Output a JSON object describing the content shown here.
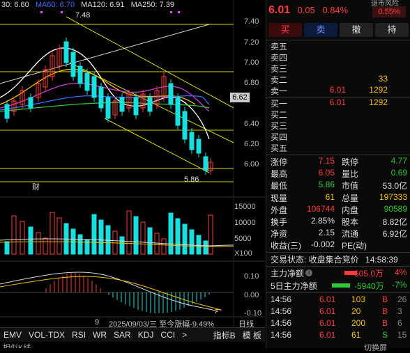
{
  "chart": {
    "legend": [
      {
        "text": "30: 6.60",
        "color": "#dddddd"
      },
      {
        "text": "MA60: 6.70",
        "color": "#3d6bff"
      },
      {
        "text": "MA120: 6.91",
        "color": "#dddddd"
      },
      {
        "text": "MA250: 7.39",
        "color": "#dddddd"
      }
    ],
    "price_ticks": [
      "7.40",
      "7.20",
      "7.00",
      "6.80",
      "6.60",
      "6.40",
      "6.20",
      "6.00"
    ],
    "current_price_tag": "6.62",
    "high_label": "7.48",
    "low_label": "5.86",
    "volume_ticks": [
      "15000",
      "10000",
      "5000",
      "X100"
    ],
    "macd_ticks": [
      "0.10",
      "0.00",
      "-0.10"
    ],
    "marker_char": "财",
    "bottom_info": "2025/09/03/三  至今涨幅-9.49%",
    "bottom_prefix": "9",
    "timeframe": "日线",
    "tabs": [
      "EMV",
      "VOL-TDX",
      "RSI",
      "WR",
      "SAR",
      "KDJ",
      "CCI",
      ">"
    ],
    "tab_right": [
      "指标B",
      "模 板"
    ],
    "bottom_cut": "相似K线",
    "bottom_cut_right": "切换屏"
  },
  "quote": {
    "price": "6.01",
    "change": "0.05",
    "change_pct": "0.84%",
    "ratio": "0.55%",
    "top_cut": "退市风险",
    "buttons": [
      {
        "label": "买",
        "color": "#ff3b3b"
      },
      {
        "label": "卖",
        "color": "#3d6bff"
      },
      {
        "label": "撤",
        "color": "#dddddd"
      },
      {
        "label": "持",
        "color": "#dddddd"
      }
    ]
  },
  "order_book": {
    "asks": [
      {
        "label": "卖五",
        "price": "",
        "vol": ""
      },
      {
        "label": "卖四",
        "price": "",
        "vol": ""
      },
      {
        "label": "卖三",
        "price": "",
        "vol": ""
      },
      {
        "label": "卖二",
        "price": "",
        "vol": "33"
      },
      {
        "label": "卖一",
        "price": "6.01",
        "vol": "1292"
      }
    ],
    "bids": [
      {
        "label": "买一",
        "price": "6.01",
        "vol": "1292"
      },
      {
        "label": "买二",
        "price": "",
        "vol": ""
      },
      {
        "label": "买三",
        "price": "",
        "vol": ""
      },
      {
        "label": "买四",
        "price": "",
        "vol": ""
      },
      {
        "label": "买五",
        "price": "",
        "vol": ""
      }
    ]
  },
  "stats": [
    {
      "l1": "涨停",
      "v1": "7.15",
      "c1": "#ff3b3b",
      "l2": "跌停",
      "v2": "4.77",
      "c2": "#2ec832"
    },
    {
      "l1": "最高",
      "v1": "6.05",
      "c1": "#ff3b3b",
      "l2": "量比",
      "v2": "0.69",
      "c2": "#2ec832"
    },
    {
      "l1": "最低",
      "v1": "5.86",
      "c1": "#2ec832",
      "l2": "市值",
      "v2": "53.0亿",
      "c2": "#dddddd"
    },
    {
      "l1": "现量",
      "v1": "61",
      "c1": "#f5c200",
      "l2": "总量",
      "v2": "197333",
      "c2": "#f5c200"
    },
    {
      "l1": "外盘",
      "v1": "106744",
      "c1": "#ff3b3b",
      "l2": "内盘",
      "v2": "90589",
      "c2": "#2ec832"
    },
    {
      "l1": "换手",
      "v1": "2.85%",
      "c1": "#dddddd",
      "l2": "股本",
      "v2": "8.82亿",
      "c2": "#dddddd"
    },
    {
      "l1": "净资",
      "v1": "2.15",
      "c1": "#dddddd",
      "l2": "流通",
      "v2": "6.92亿",
      "c2": "#dddddd"
    },
    {
      "l1": "收益(三)",
      "v1": "-0.002",
      "c1": "#dddddd",
      "l2": "PE(动)",
      "v2": "",
      "c2": "#dddddd"
    }
  ],
  "trade_status": {
    "label": "交易状态: 收盘集合竞价",
    "time": "14:58:39"
  },
  "capital_flow": [
    {
      "label": "主力净额",
      "value": "505.0万",
      "pct": "4%",
      "color": "#ff3b3b"
    },
    {
      "label": "5日主力净额",
      "value": "-5940万",
      "pct": "-7%",
      "color": "#2ec832"
    }
  ],
  "ticks": [
    {
      "time": "14:56",
      "price": "6.01",
      "vol": "103",
      "side": "B",
      "n": "26"
    },
    {
      "time": "14:56",
      "price": "6.01",
      "vol": "20",
      "side": "B",
      "n": "3"
    },
    {
      "time": "14:56",
      "price": "6.01",
      "vol": "200",
      "side": "B",
      "n": "6"
    },
    {
      "time": "14:56",
      "price": "6.01",
      "vol": "61",
      "side": "S",
      "n": "15"
    }
  ]
}
